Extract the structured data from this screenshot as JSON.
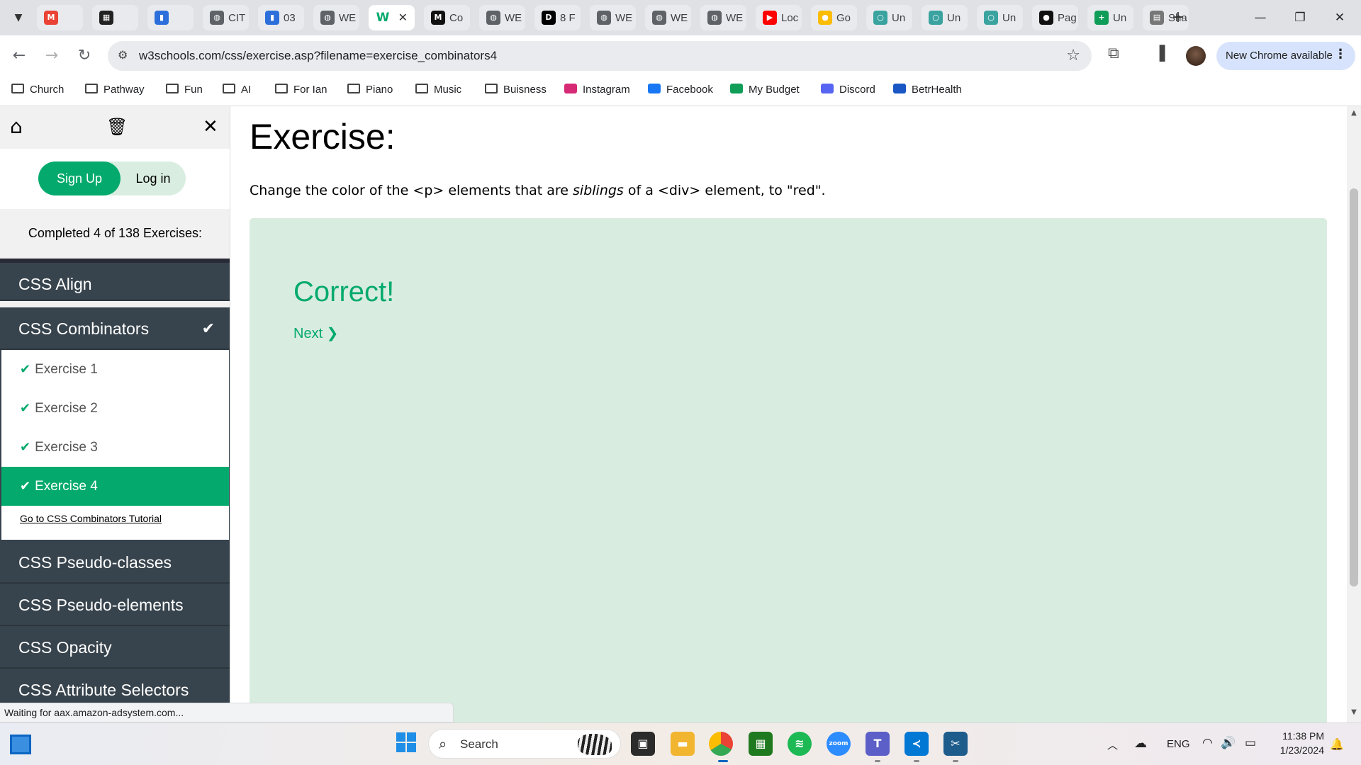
{
  "browser": {
    "tabs": [
      {
        "label": "",
        "icon": "gmail-icon",
        "color": "#ea4335",
        "glyph": "M"
      },
      {
        "label": "",
        "icon": "app-icon",
        "color": "#222222",
        "glyph": "▦"
      },
      {
        "label": "",
        "icon": "chart-icon",
        "color": "#2c6fdb",
        "glyph": "▮"
      },
      {
        "label": "CIT",
        "icon": "globe-icon",
        "color": "#5f6368",
        "glyph": "◍"
      },
      {
        "label": "03",
        "icon": "chart-icon",
        "color": "#2c6fdb",
        "glyph": "▮"
      },
      {
        "label": "WE",
        "icon": "globe-icon",
        "color": "#5f6368",
        "glyph": "◍"
      },
      {
        "label": "",
        "icon": "w3schools-icon",
        "color": "#04aa6d",
        "glyph": "W"
      },
      {
        "label": "Co",
        "icon": "m-icon",
        "color": "#111111",
        "glyph": "M"
      },
      {
        "label": "WE",
        "icon": "globe-icon",
        "color": "#5f6368",
        "glyph": "◍"
      },
      {
        "label": "8 F",
        "icon": "dev-icon",
        "color": "#000000",
        "glyph": "D"
      },
      {
        "label": "WE",
        "icon": "globe-icon",
        "color": "#5f6368",
        "glyph": "◍"
      },
      {
        "label": "WE",
        "icon": "globe-icon",
        "color": "#5f6368",
        "glyph": "◍"
      },
      {
        "label": "WE",
        "icon": "globe-icon",
        "color": "#5f6368",
        "glyph": "◍"
      },
      {
        "label": "Loc",
        "icon": "youtube-icon",
        "color": "#ff0000",
        "glyph": "▶"
      },
      {
        "label": "Go",
        "icon": "keep-icon",
        "color": "#fbbc04",
        "glyph": "●"
      },
      {
        "label": "Un",
        "icon": "circle-icon",
        "color": "#3aa3a0",
        "glyph": "○"
      },
      {
        "label": "Un",
        "icon": "circle-icon",
        "color": "#3aa3a0",
        "glyph": "○"
      },
      {
        "label": "Un",
        "icon": "circle-icon",
        "color": "#3aa3a0",
        "glyph": "○"
      },
      {
        "label": "Pag",
        "icon": "github-icon",
        "color": "#111111",
        "glyph": "●"
      },
      {
        "label": "Un",
        "icon": "sheets-icon",
        "color": "#0f9d58",
        "glyph": "+"
      },
      {
        "label": "Sha",
        "icon": "share-icon",
        "color": "#777777",
        "glyph": "▤"
      }
    ],
    "active_tab_index": 6,
    "url": "w3schools.com/css/exercise.asp?filename=exercise_combinators4",
    "update_chip": "New Chrome available",
    "bookmarks": [
      {
        "label": "Church",
        "icon": "folder-icon"
      },
      {
        "label": "Pathway",
        "icon": "folder-icon"
      },
      {
        "label": "Fun",
        "icon": "folder-icon"
      },
      {
        "label": "AI",
        "icon": "folder-icon"
      },
      {
        "label": "For Ian",
        "icon": "folder-icon"
      },
      {
        "label": "Piano",
        "icon": "folder-icon"
      },
      {
        "label": "Music",
        "icon": "folder-icon"
      },
      {
        "label": "Buisness",
        "icon": "folder-icon"
      },
      {
        "label": "Instagram",
        "icon": "instagram-icon",
        "color": "#d62976"
      },
      {
        "label": "Facebook",
        "icon": "facebook-icon",
        "color": "#1877f2"
      },
      {
        "label": "My Budget",
        "icon": "budget-icon",
        "color": "#0f9d58"
      },
      {
        "label": "Discord",
        "icon": "discord-icon",
        "color": "#5865f2"
      },
      {
        "label": "BetrHealth",
        "icon": "betrhealth-icon",
        "color": "#1a56c4"
      }
    ],
    "status_text": "Waiting for aax.amazon-adsystem.com..."
  },
  "sidebar": {
    "signup_label": "Sign Up",
    "login_label": "Log in",
    "progress_text": "Completed 4 of 138 Exercises:",
    "categories_above": [
      {
        "label": "CSS Align"
      },
      {
        "label": "CSS Combinators",
        "completed": true
      }
    ],
    "exercises": [
      {
        "label": "Exercise 1",
        "done": true
      },
      {
        "label": "Exercise 2",
        "done": true
      },
      {
        "label": "Exercise 3",
        "done": true
      },
      {
        "label": "Exercise 4",
        "done": true,
        "active": true
      }
    ],
    "tutorial_link": "Go to CSS Combinators Tutorial",
    "categories_below": [
      {
        "label": "CSS Pseudo-classes"
      },
      {
        "label": "CSS Pseudo-elements"
      },
      {
        "label": "CSS Opacity"
      },
      {
        "label": "CSS Attribute Selectors"
      }
    ]
  },
  "main": {
    "heading": "Exercise:",
    "instruction_before": "Change the color of the <p> elements that are ",
    "instruction_em": "siblings",
    "instruction_after": " of a <div> element, to \"red\".",
    "result_title": "Correct!",
    "next_label": "Next ❯"
  },
  "taskbar": {
    "search_label": "Search",
    "language": "ENG",
    "time": "11:38 PM",
    "date": "1/23/2024"
  },
  "colors": {
    "accent": "#04aa6d",
    "sidebar_dark": "#38444d",
    "result_bg": "#d9ece0"
  }
}
